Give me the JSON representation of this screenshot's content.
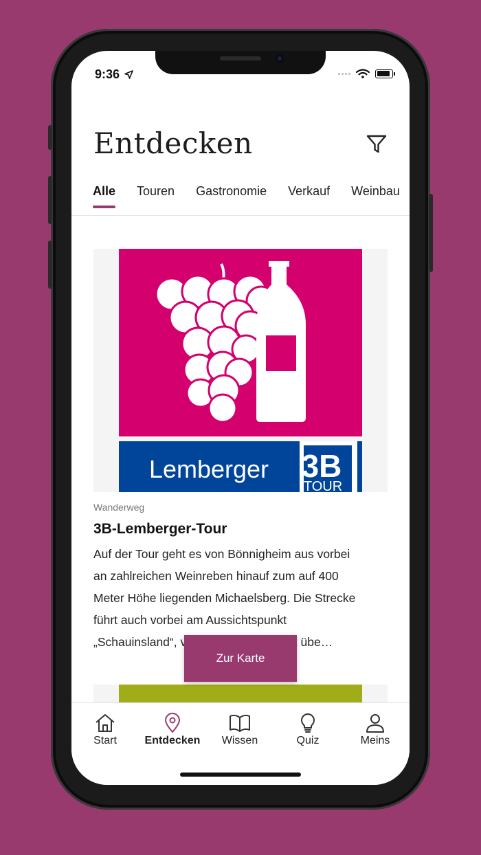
{
  "status_bar": {
    "time": "9:36"
  },
  "header": {
    "title": "Entdecken",
    "filter_icon": "filter-icon"
  },
  "tabs": [
    {
      "label": "Alle",
      "active": true
    },
    {
      "label": "Touren",
      "active": false
    },
    {
      "label": "Gastronomie",
      "active": false
    },
    {
      "label": "Verkauf",
      "active": false
    },
    {
      "label": "Weinbau",
      "active": false
    }
  ],
  "card": {
    "image": {
      "brand_text": "Lemberger",
      "badge_top": "3B",
      "badge_bottom": "TOUR",
      "pink": "#d4006e",
      "blue": "#00459a"
    },
    "category": "Wanderweg",
    "title": "3B-Lemberger-Tour",
    "description_lines": [
      "Auf der Tour geht es von Bönnigheim aus vorbei",
      "an zahlreichen Weinreben hinauf zum auf 400",
      "Meter Höhe liegenden Michaelsberg. Die Strecke",
      "führt auch vorbei am Aussichtspunkt",
      "„Schauinsland“, von wo man den Blick übe…"
    ]
  },
  "map_button": {
    "label": "Zur Karte"
  },
  "tabbar": [
    {
      "label": "Start",
      "icon": "home-icon",
      "active": false
    },
    {
      "label": "Entdecken",
      "icon": "map-pin-icon",
      "active": true
    },
    {
      "label": "Wissen",
      "icon": "book-icon",
      "active": false
    },
    {
      "label": "Quiz",
      "icon": "lightbulb-icon",
      "active": false
    },
    {
      "label": "Meins",
      "icon": "person-icon",
      "active": false
    }
  ],
  "colors": {
    "accent": "#983a6e",
    "background": "#983a6e",
    "next_card_green": "#a0ac18"
  }
}
